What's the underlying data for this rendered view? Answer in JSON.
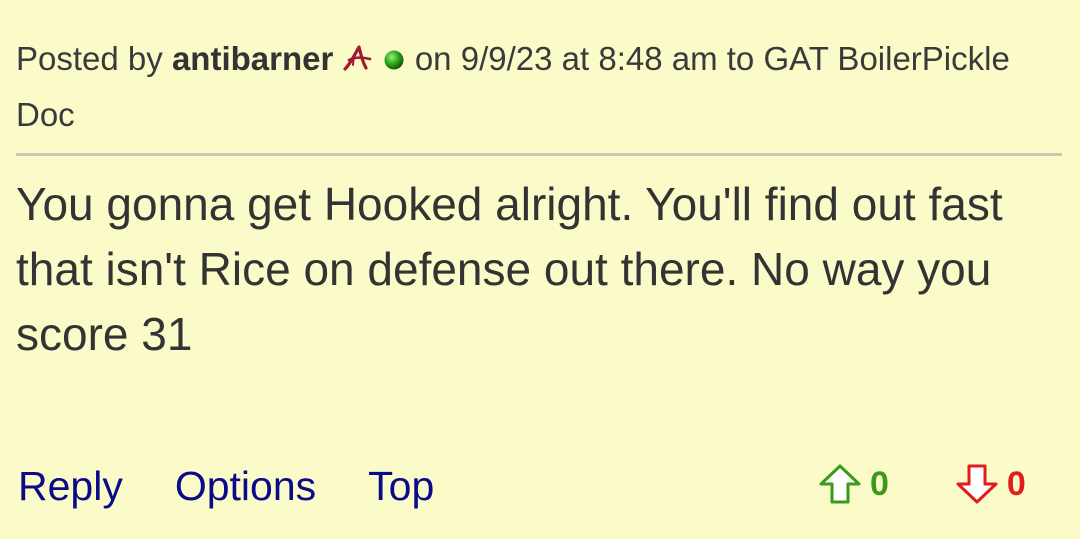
{
  "post": {
    "posted_by_label": "Posted by",
    "author": "antibarner",
    "on_label": "on",
    "date": "9/9/23",
    "at_label": "at",
    "time": "8:48 am",
    "to_label": "to",
    "recipient": "GAT BoilerPickle Doc",
    "body": "You gonna get Hooked alright. You'll find out fast that isn't Rice on defense out there. No way you score 31",
    "team_icon": "alabama-script-a-icon",
    "status_icon": "online-green-dot-icon"
  },
  "actions": {
    "reply_label": "Reply",
    "options_label": "Options",
    "top_label": "Top"
  },
  "votes": {
    "up_count": "0",
    "down_count": "0",
    "up_color": "#3a9a1a",
    "down_color": "#e11c1c"
  },
  "colors": {
    "background": "#FBFBC9",
    "link": "#0b0b8a",
    "text": "#333333"
  }
}
